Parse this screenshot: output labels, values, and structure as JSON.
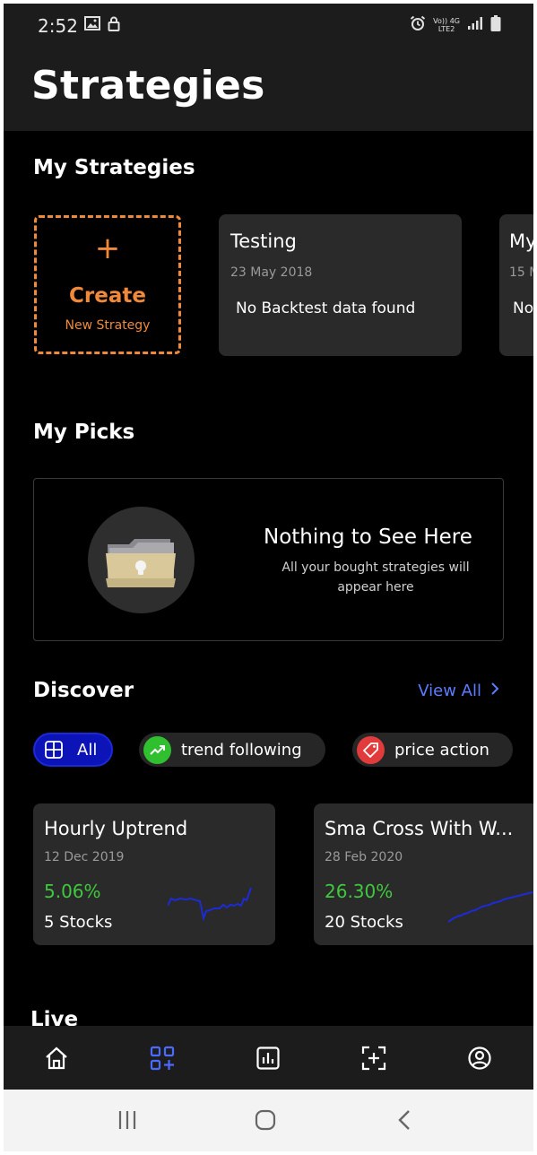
{
  "status_bar": {
    "time": "2:52",
    "net_top": "Vo)) 4G",
    "net_bottom": "LTE2"
  },
  "header": {
    "title": "Strategies"
  },
  "my_strategies": {
    "title": "My Strategies",
    "create": {
      "plus": "+",
      "label": "Create",
      "sub": "New Strategy"
    },
    "cards": [
      {
        "name": "Testing",
        "date": "23 May 2018",
        "message": "No Backtest data found"
      },
      {
        "name": "My",
        "date": "15 M",
        "message": "No"
      }
    ]
  },
  "my_picks": {
    "title": "My Picks",
    "empty_title": "Nothing to See Here",
    "empty_sub": "All your bought strategies will appear here"
  },
  "discover": {
    "title": "Discover",
    "view_all": "View All",
    "chips": [
      {
        "label": "All",
        "icon": "grid-icon"
      },
      {
        "label": "trend following",
        "icon": "trend-up-icon"
      },
      {
        "label": "price action",
        "icon": "tag-icon"
      }
    ],
    "cards": [
      {
        "name": "Hourly Uptrend",
        "date": "12 Dec 2019",
        "return": "5.06%",
        "stocks": "5 Stocks"
      },
      {
        "name": "Sma Cross With W...",
        "date": "28 Feb 2020",
        "return": "26.30%",
        "stocks": "20 Stocks"
      }
    ]
  },
  "live": {
    "title": "Live"
  },
  "colors": {
    "accent_orange": "#f08a3a",
    "accent_blue": "#5c7cff",
    "positive_green": "#3ec93e",
    "card_bg": "#2a2a2a"
  }
}
